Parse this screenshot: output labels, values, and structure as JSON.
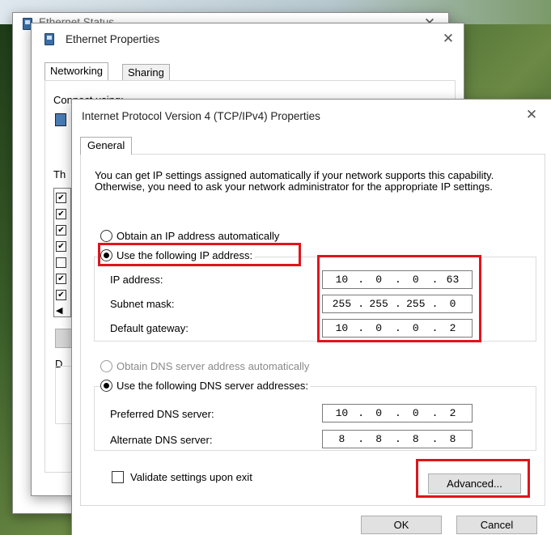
{
  "ethernet_status": {
    "title": "Ethernet Status"
  },
  "ethernet_properties": {
    "title": "Ethernet Properties",
    "tabs": [
      "Networking",
      "Sharing"
    ],
    "connect_using_label": "Connect using:",
    "this_connection_label": "Th",
    "description_label": "D"
  },
  "ipv4": {
    "title": "Internet Protocol Version 4 (TCP/IPv4) Properties",
    "tab": "General",
    "info_text": "You can get IP settings assigned automatically if your network supports this capability. Otherwise, you need to ask your network administrator for the appropriate IP settings.",
    "ip_auto_label": "Obtain an IP address automatically",
    "ip_manual_label": "Use the following IP address:",
    "ip_label": "IP address:",
    "ip_value": [
      "10",
      "0",
      "0",
      "63"
    ],
    "subnet_label": "Subnet mask:",
    "subnet_value": [
      "255",
      "255",
      "255",
      "0"
    ],
    "gateway_label": "Default gateway:",
    "gateway_value": [
      "10",
      "0",
      "0",
      "2"
    ],
    "dns_auto_label": "Obtain DNS server address automatically",
    "dns_manual_label": "Use the following DNS server addresses:",
    "preferred_dns_label": "Preferred DNS server:",
    "preferred_dns_value": [
      "10",
      "0",
      "0",
      "2"
    ],
    "alternate_dns_label": "Alternate DNS server:",
    "alternate_dns_value": [
      "8",
      "8",
      "8",
      "8"
    ],
    "validate_label": "Validate settings upon exit",
    "advanced_label": "Advanced...",
    "ok_label": "OK",
    "cancel_label": "Cancel",
    "close_glyph": "✕"
  },
  "colors": {
    "highlight": "#e0141c"
  }
}
